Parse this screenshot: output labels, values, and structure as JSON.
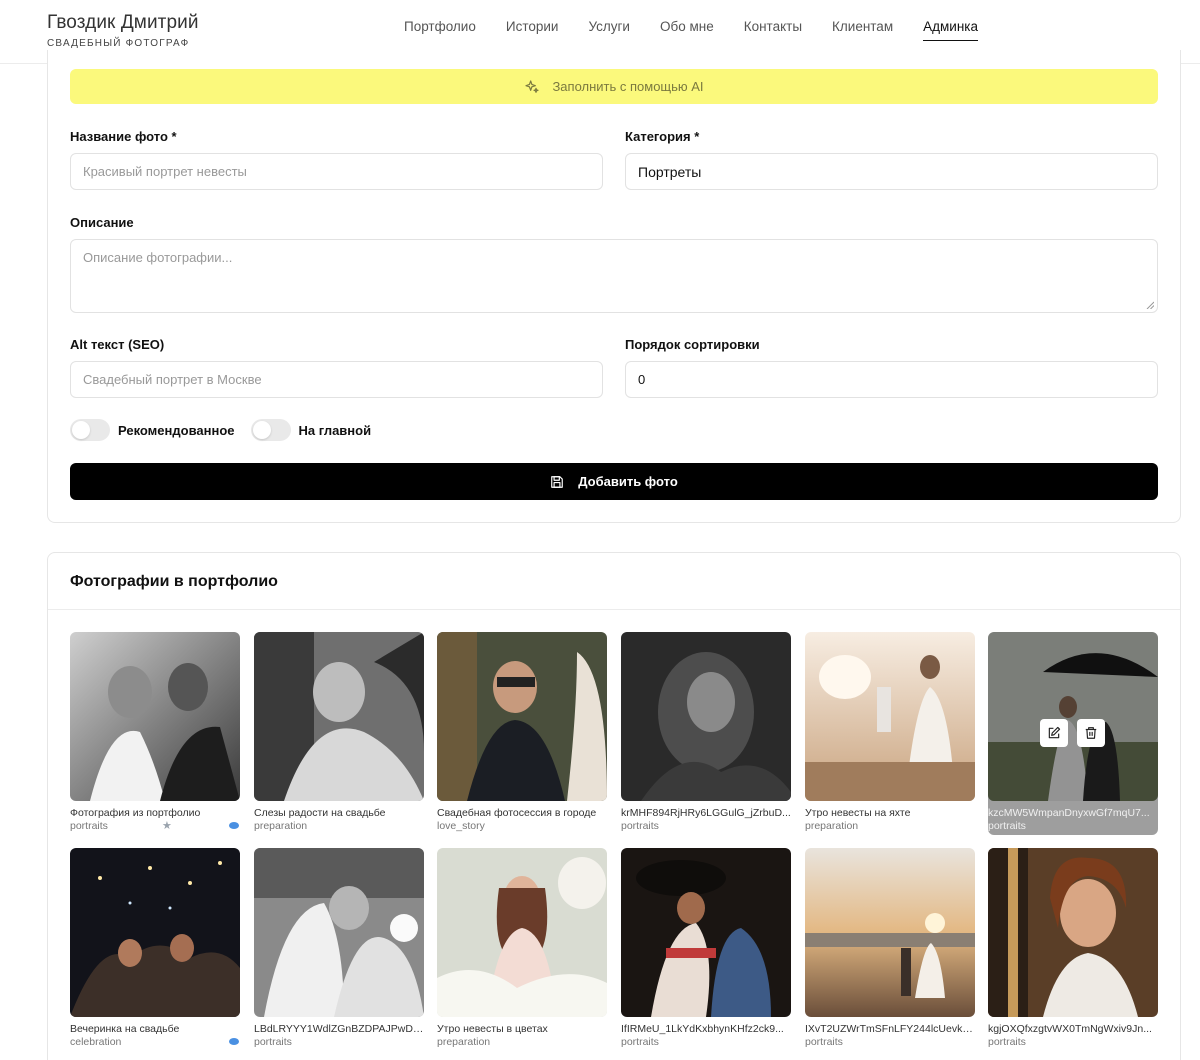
{
  "header": {
    "brand_name": "Гвоздик Дмитрий",
    "brand_sub": "СВАДЕБНЫЙ ФОТОГРАФ",
    "nav": [
      "Портфолио",
      "Истории",
      "Услуги",
      "Обо мне",
      "Контакты",
      "Клиентам",
      "Админка"
    ],
    "active_nav": "Админка"
  },
  "form": {
    "ai_button": "Заполнить с помощью AI",
    "title_label": "Название фото *",
    "title_placeholder": "Красивый портрет невесты",
    "category_label": "Категория *",
    "category_value": "Портреты",
    "description_label": "Описание",
    "description_placeholder": "Описание фотографии...",
    "alt_label": "Alt текст (SEO)",
    "alt_placeholder": "Свадебный портрет в Москве",
    "sort_label": "Порядок сортировки",
    "sort_value": "0",
    "featured_label": "Рекомендованное",
    "homepage_label": "На главной",
    "submit_label": "Добавить фото"
  },
  "gallery": {
    "title": "Фотографии в портфолио",
    "items": [
      {
        "caption": "Фотография из портфолио",
        "category": "portraits",
        "featured": true,
        "homepage": true
      },
      {
        "caption": "Слезы радости на свадьбе",
        "category": "preparation",
        "featured": false,
        "homepage": false
      },
      {
        "caption": "Свадебная фотосессия в городе",
        "category": "love_story",
        "featured": false,
        "homepage": false
      },
      {
        "caption": "krMHF894RjHRy6LGGulG_jZrbuD...",
        "category": "portraits",
        "featured": false,
        "homepage": false
      },
      {
        "caption": "Утро невесты на яхте",
        "category": "preparation",
        "featured": false,
        "homepage": false
      },
      {
        "caption": "kzcMW5WmpanDnyxwGf7mqU7...",
        "category": "portraits",
        "featured": false,
        "homepage": false
      },
      {
        "caption": "Вечеринка на свадьбе",
        "category": "celebration",
        "featured": false,
        "homepage": true
      },
      {
        "caption": "LBdLRYYY1WdlZGnBZDPAJPwDu...",
        "category": "portraits",
        "featured": false,
        "homepage": false
      },
      {
        "caption": "Утро невесты в цветах",
        "category": "preparation",
        "featured": false,
        "homepage": false
      },
      {
        "caption": "IfIRMeU_1LkYdKxbhynKHfz2ck9...",
        "category": "portraits",
        "featured": false,
        "homepage": false
      },
      {
        "caption": "IXvT2UZWrTmSFnLFY244lcUevkp...",
        "category": "portraits",
        "featured": false,
        "homepage": false
      },
      {
        "caption": "kgjOXQfxzgtvWX0TmNgWxiv9Jn...",
        "category": "portraits",
        "featured": false,
        "homepage": false
      }
    ]
  },
  "colors": {
    "ai_bar": "#fbf97c",
    "submit": "#000000",
    "homepage_dot": "#4a90e2"
  }
}
